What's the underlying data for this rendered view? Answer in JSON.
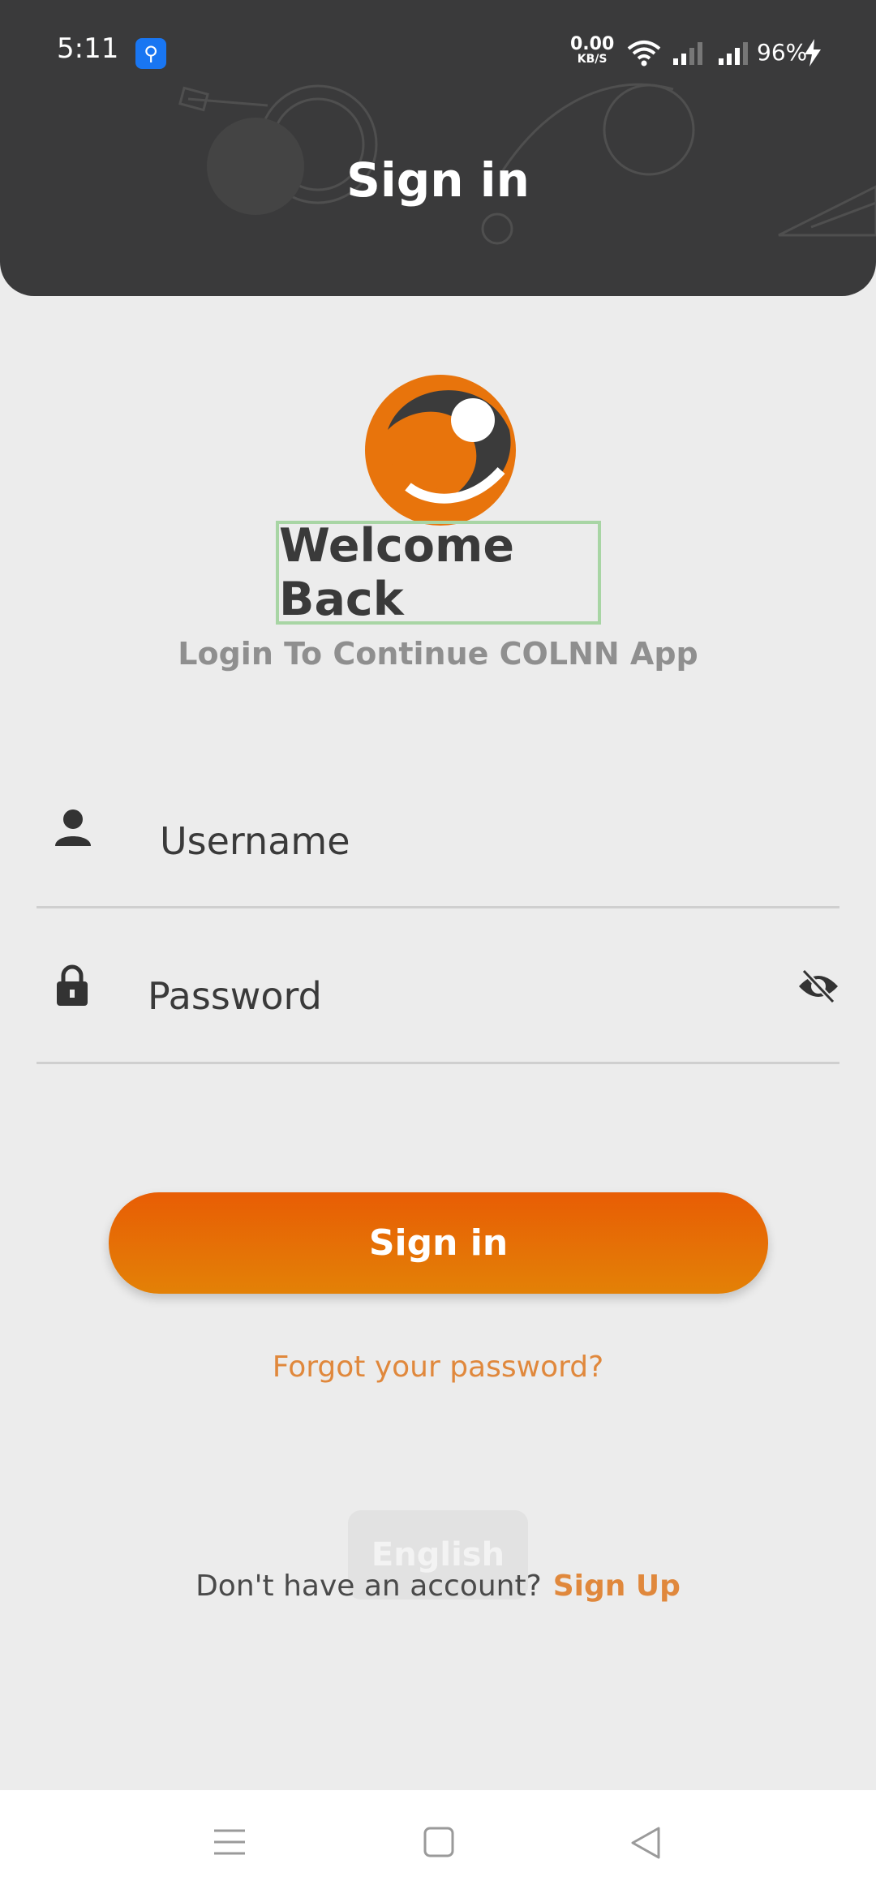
{
  "status_bar": {
    "time": "5:11",
    "net_speed_value": "0.00",
    "net_speed_unit": "KB/S",
    "battery": "96%",
    "icons": [
      "usb-debug-icon",
      "wifi-icon",
      "signal-icon",
      "signal-icon",
      "charging-icon"
    ]
  },
  "header": {
    "title": "Sign in"
  },
  "welcome": {
    "title": "Welcome Back",
    "subtitle": "Login To Continue COLNN App"
  },
  "form": {
    "username_placeholder": "Username",
    "password_placeholder": "Password"
  },
  "actions": {
    "signin_label": "Sign in",
    "forgot_label": "Forgot your password?",
    "language_label": "English",
    "no_account_text": "Don't have an account?",
    "signup_label": "Sign Up"
  },
  "colors": {
    "header_bg": "#3a3a3b",
    "page_bg": "#ececec",
    "accent": "#e8620a",
    "link": "#e0883c"
  }
}
